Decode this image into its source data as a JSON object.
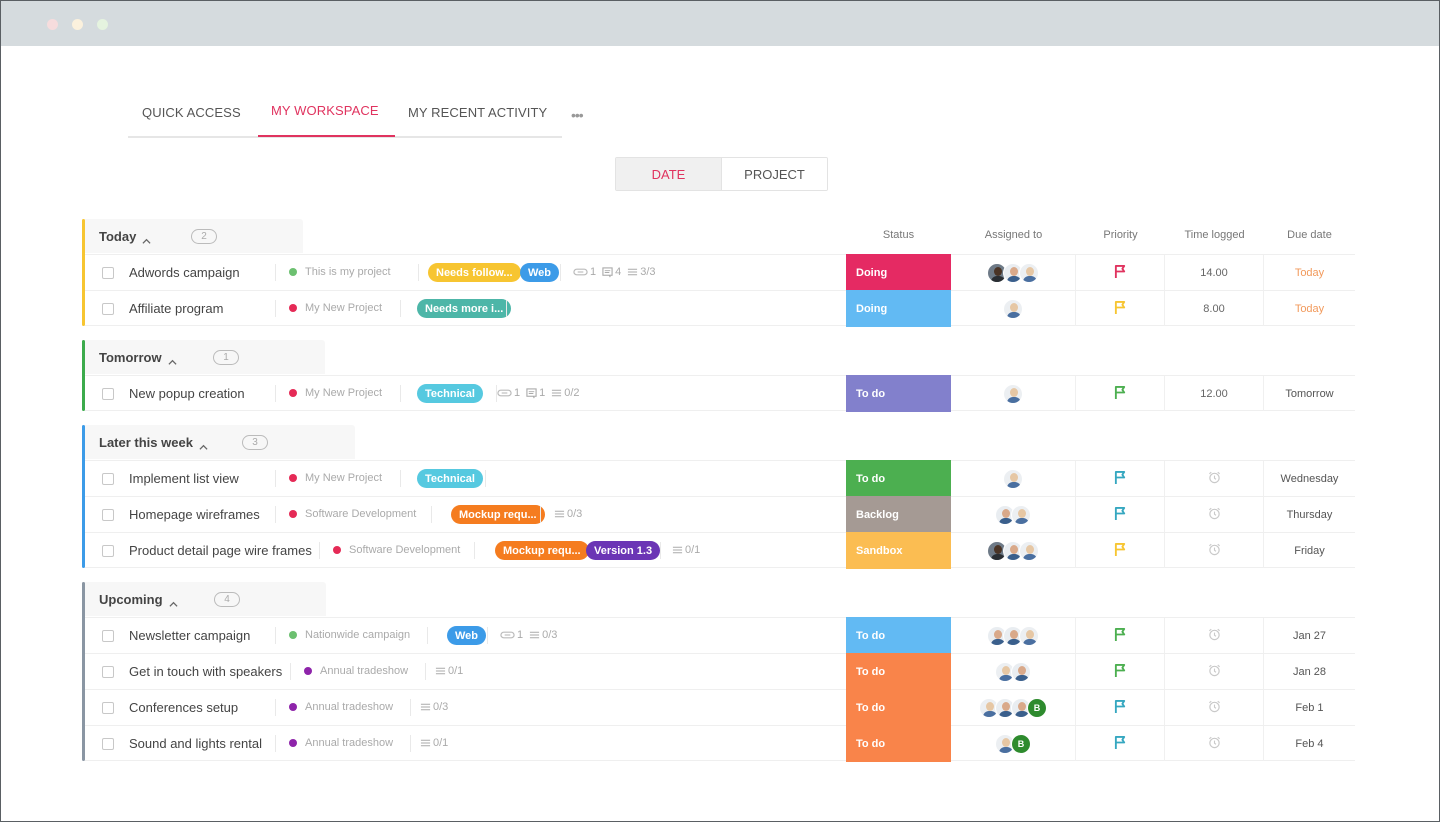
{
  "window": {
    "controls": [
      "close",
      "minimize",
      "maximize"
    ]
  },
  "tabs": [
    {
      "label": "QUICK ACCESS",
      "active": false
    },
    {
      "label": "MY WORKSPACE",
      "active": true
    },
    {
      "label": "MY RECENT ACTIVITY",
      "active": false
    }
  ],
  "more_label": "•••",
  "group_by": {
    "options": [
      "DATE",
      "PROJECT"
    ],
    "selected": "DATE"
  },
  "columns": {
    "status": "Status",
    "assigned": "Assigned to",
    "priority": "Priority",
    "time": "Time logged",
    "due": "Due date"
  },
  "colors": {
    "accent": "#e0335f",
    "today": "#f7c531",
    "tomorrow": "#3cab4c",
    "later": "#3c9be8",
    "upcoming": "#8a96a3",
    "overdue_text": "#f29a5c"
  },
  "groups": [
    {
      "title": "Today",
      "count": "2",
      "bar_color": "#f7c531",
      "tasks": [
        {
          "name": "Adwords campaign",
          "project": "This is my project",
          "project_color": "#6cc070",
          "tags": [
            {
              "label": "Needs follow...",
              "color": "#f7c531"
            },
            {
              "label": "Web",
              "color": "#3c9be8"
            }
          ],
          "meta": {
            "attachments": "1",
            "comments": "4",
            "subtasks": "3/3"
          },
          "status": {
            "label": "Doing",
            "color": "#e52a63"
          },
          "assignees": [
            "dark",
            "man",
            "blonde"
          ],
          "priority_color": "#e0335f",
          "time": "14.00",
          "due": "Today",
          "due_color": "#f29a5c"
        },
        {
          "name": "Affiliate program",
          "project": "My New Project",
          "project_color": "#e52a56",
          "tags": [
            {
              "label": "Needs more i...",
              "color": "#4db6a8"
            }
          ],
          "meta": {},
          "status": {
            "label": "Doing",
            "color": "#62baf3"
          },
          "assignees": [
            "blonde"
          ],
          "priority_color": "#f7c531",
          "time": "8.00",
          "due": "Today",
          "due_color": "#f29a5c"
        }
      ]
    },
    {
      "title": "Tomorrow",
      "count": "1",
      "bar_color": "#3cab4c",
      "tasks": [
        {
          "name": "New popup creation",
          "project": "My New Project",
          "project_color": "#e52a56",
          "tags": [
            {
              "label": "Technical",
              "color": "#56c9e0"
            }
          ],
          "meta": {
            "attachments": "1",
            "comments": "1",
            "subtasks": "0/2"
          },
          "status": {
            "label": "To do",
            "color": "#8280cc"
          },
          "assignees": [
            "blonde"
          ],
          "priority_color": "#4caf50",
          "time": "12.00",
          "due": "Tomorrow",
          "due_color": "#555555"
        }
      ]
    },
    {
      "title": "Later this week",
      "count": "3",
      "bar_color": "#3c9be8",
      "tasks": [
        {
          "name": "Implement list view",
          "project": "My New Project",
          "project_color": "#e52a56",
          "tags": [
            {
              "label": "Technical",
              "color": "#56c9e0"
            }
          ],
          "meta": {},
          "status": {
            "label": "To do",
            "color": "#4caf50"
          },
          "assignees": [
            "blonde"
          ],
          "priority_color": "#35a7c0",
          "time": "",
          "due": "Wednesday",
          "due_color": "#555555"
        },
        {
          "name": "Homepage wireframes",
          "project": "Software Development",
          "project_color": "#e52a56",
          "tags": [
            {
              "label": "Mockup requ...",
              "color": "#f57c1f"
            }
          ],
          "meta": {
            "subtasks": "0/3"
          },
          "status": {
            "label": "Backlog",
            "color": "#a59a94"
          },
          "assignees": [
            "man",
            "blonde"
          ],
          "priority_color": "#35a7c0",
          "time": "",
          "due": "Thursday",
          "due_color": "#555555"
        },
        {
          "name": "Product detail page wire frames",
          "project": "Software Development",
          "project_color": "#e52a56",
          "tags": [
            {
              "label": "Mockup requ...",
              "color": "#f57c1f"
            },
            {
              "label": "Version 1.3",
              "color": "#6b35b5"
            }
          ],
          "meta": {
            "subtasks": "0/1"
          },
          "status": {
            "label": "Sandbox",
            "color": "#fbbd52"
          },
          "assignees": [
            "dark",
            "man",
            "blonde"
          ],
          "priority_color": "#f7c531",
          "time": "",
          "due": "Friday",
          "due_color": "#555555"
        }
      ]
    },
    {
      "title": "Upcoming",
      "count": "4",
      "bar_color": "#8a96a3",
      "tasks": [
        {
          "name": "Newsletter campaign",
          "project": "Nationwide campaign",
          "project_color": "#6cc070",
          "tags": [
            {
              "label": "Web",
              "color": "#3c9be8"
            }
          ],
          "meta": {
            "attachments": "1",
            "subtasks": "0/3"
          },
          "status": {
            "label": "To do",
            "color": "#62baf3"
          },
          "assignees": [
            "man",
            "man",
            "blonde"
          ],
          "priority_color": "#4caf50",
          "time": "",
          "due": "Jan 27",
          "due_color": "#555555"
        },
        {
          "name": "Get in touch with speakers",
          "project": "Annual tradeshow",
          "project_color": "#8e24aa",
          "tags": [],
          "meta": {
            "subtasks": "0/1"
          },
          "status": {
            "label": "To do",
            "color": "#f9844a"
          },
          "assignees": [
            "blonde",
            "man"
          ],
          "priority_color": "#4caf50",
          "time": "",
          "due": "Jan 28",
          "due_color": "#555555"
        },
        {
          "name": "Conferences setup",
          "project": "Annual tradeshow",
          "project_color": "#8e24aa",
          "tags": [],
          "meta": {
            "subtasks": "0/3"
          },
          "status": {
            "label": "To do",
            "color": "#f9844a"
          },
          "assignees": [
            "blonde",
            "man",
            "man",
            "B"
          ],
          "priority_color": "#35a7c0",
          "time": "",
          "due": "Feb 1",
          "due_color": "#555555"
        },
        {
          "name": "Sound and lights rental",
          "project": "Annual tradeshow",
          "project_color": "#8e24aa",
          "tags": [],
          "meta": {
            "subtasks": "0/1"
          },
          "status": {
            "label": "To do",
            "color": "#f9844a"
          },
          "assignees": [
            "blonde",
            "B"
          ],
          "priority_color": "#35a7c0",
          "time": "",
          "due": "Feb 4",
          "due_color": "#555555"
        }
      ]
    }
  ]
}
